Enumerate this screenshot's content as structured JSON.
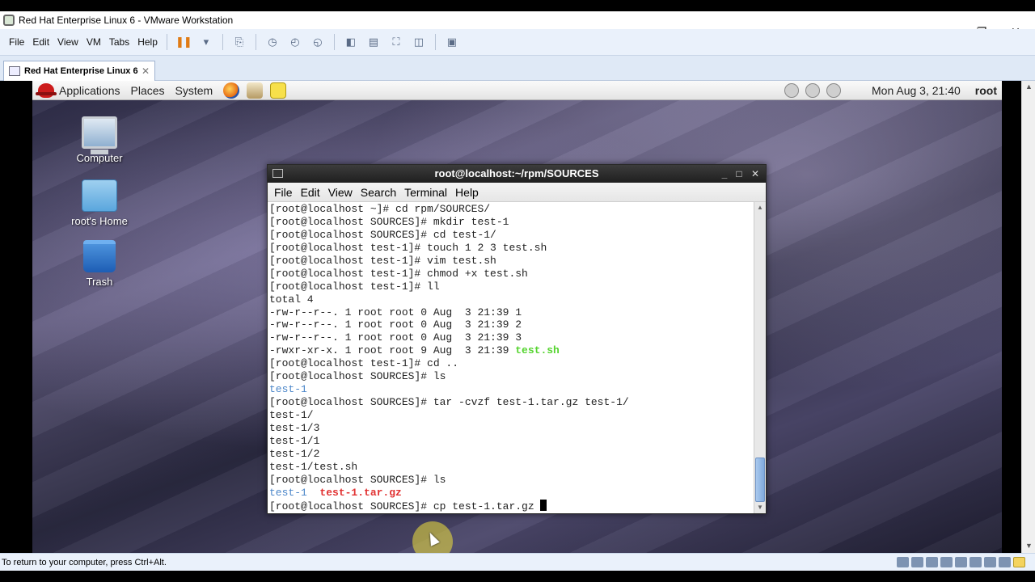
{
  "host": {
    "window_title": "Red Hat Enterprise Linux 6 - VMware Workstation",
    "menu": [
      "File",
      "Edit",
      "View",
      "VM",
      "Tabs",
      "Help"
    ],
    "tab_label": "Red Hat Enterprise Linux 6",
    "status_text": "To return to your computer, press Ctrl+Alt."
  },
  "guest": {
    "panel": {
      "applications": "Applications",
      "places": "Places",
      "system": "System",
      "clock": "Mon Aug  3, 21:40",
      "user": "root"
    },
    "desktop_icons": [
      {
        "label": "Computer",
        "icon": "computer-icon"
      },
      {
        "label": "root's Home",
        "icon": "home-folder-icon"
      },
      {
        "label": "Trash",
        "icon": "trash-icon"
      }
    ],
    "terminal": {
      "title": "root@localhost:~/rpm/SOURCES",
      "menu": [
        "File",
        "Edit",
        "View",
        "Search",
        "Terminal",
        "Help"
      ],
      "lines": [
        {
          "text": "[root@localhost ~]# cd rpm/SOURCES/"
        },
        {
          "text": "[root@localhost SOURCES]# mkdir test-1"
        },
        {
          "text": "[root@localhost SOURCES]# cd test-1/"
        },
        {
          "text": "[root@localhost test-1]# touch 1 2 3 test.sh"
        },
        {
          "text": "[root@localhost test-1]# vim test.sh"
        },
        {
          "text": "[root@localhost test-1]# chmod +x test.sh"
        },
        {
          "text": "[root@localhost test-1]# ll"
        },
        {
          "text": "total 4"
        },
        {
          "text": "-rw-r--r--. 1 root root 0 Aug  3 21:39 1"
        },
        {
          "text": "-rw-r--r--. 1 root root 0 Aug  3 21:39 2"
        },
        {
          "text": "-rw-r--r--. 1 root root 0 Aug  3 21:39 3"
        },
        {
          "text": "-rwxr-xr-x. 1 root root 9 Aug  3 21:39 ",
          "extra": "test.sh",
          "extra_class": "c-green"
        },
        {
          "text": "[root@localhost test-1]# cd .."
        },
        {
          "text": "[root@localhost SOURCES]# ls"
        },
        {
          "text": "test-1",
          "cls": "c-blue"
        },
        {
          "text": "[root@localhost SOURCES]# tar -cvzf test-1.tar.gz test-1/"
        },
        {
          "text": "test-1/"
        },
        {
          "text": "test-1/3"
        },
        {
          "text": "test-1/1"
        },
        {
          "text": "test-1/2"
        },
        {
          "text": "test-1/test.sh"
        },
        {
          "text": "[root@localhost SOURCES]# ls"
        },
        {
          "text": "test-1",
          "cls": "c-blue",
          "extra": "  test-1.tar.gz",
          "extra_class": "c-red"
        },
        {
          "text": "[root@localhost SOURCES]# cp test-1.tar.gz ",
          "cursor": true
        }
      ]
    }
  },
  "colors": {
    "terminal_green": "#55d42f",
    "terminal_blue": "#4b86c9",
    "terminal_red": "#e13232"
  }
}
